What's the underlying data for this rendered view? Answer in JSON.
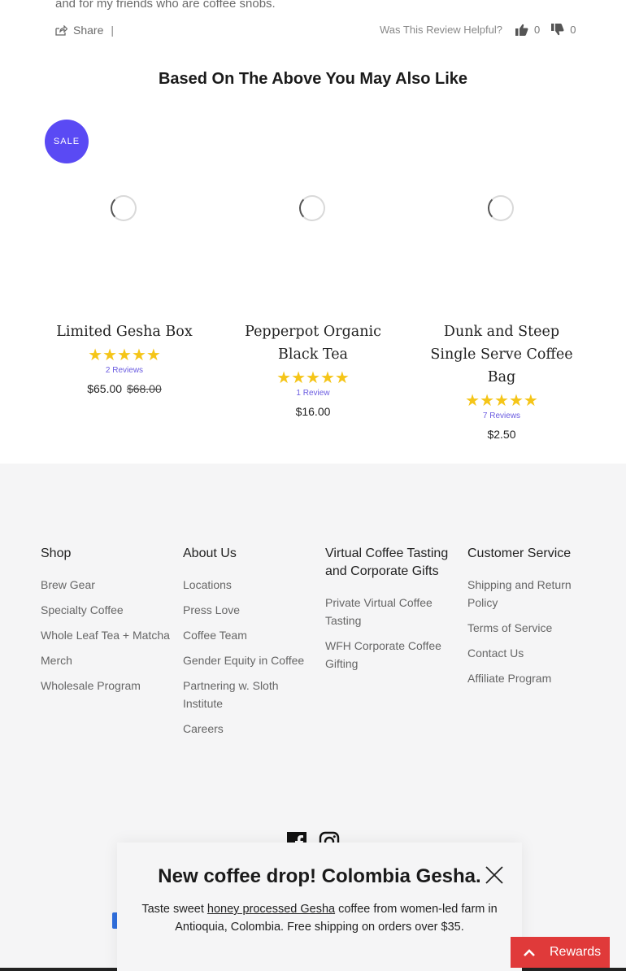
{
  "review": {
    "tail_text": "and for my friends who are coffee snobs.",
    "share_label": "Share",
    "separator": "|",
    "helpful_label": "Was This Review Helpful?",
    "up_count": "0",
    "down_count": "0"
  },
  "recommendations": {
    "title": "Based On The Above You May Also Like",
    "sale_badge": "SALE",
    "star_color": "#f5c518",
    "products": [
      {
        "name": "Limited Gesha Box",
        "stars": "★★★★★",
        "reviews": "2 Reviews",
        "price": "$65.00",
        "old_price": "$68.00"
      },
      {
        "name": "Pepperpot Organic Black Tea",
        "stars": "★★★★★",
        "reviews": "1 Review",
        "price": "$16.00"
      },
      {
        "name": "Dunk and Steep Single Serve Coffee Bag",
        "stars": "★★★★★",
        "reviews": "7 Reviews",
        "price": "$2.50"
      }
    ]
  },
  "footer": {
    "columns": [
      {
        "title": "Shop",
        "links": [
          "Brew Gear",
          "Specialty Coffee",
          "Whole Leaf Tea + Matcha",
          "Merch",
          "Wholesale Program"
        ]
      },
      {
        "title": "About Us",
        "links": [
          "Locations",
          "Press Love",
          "Coffee Team",
          "Gender Equity in Coffee",
          "Partnering w. Sloth Institute",
          "Careers"
        ]
      },
      {
        "title": "Virtual Coffee Tasting and Corporate Gifts",
        "links": [
          "Private Virtual Coffee Tasting",
          "WFH Corporate Coffee Gifting"
        ]
      },
      {
        "title": "Customer Service",
        "links": [
          "Shipping and Return Policy",
          "Terms of Service",
          "Contact Us",
          "Affiliate Program"
        ]
      }
    ],
    "social_icons": [
      "facebook-icon",
      "instagram-icon"
    ]
  },
  "popup": {
    "title": "New coffee drop! Colombia Gesha.",
    "text_before": "Taste sweet ",
    "link_text": "honey processed Gesha",
    "text_after": " coffee from women-led farm in Antioquia, Colombia. Free shipping on orders over $35."
  },
  "rewards": {
    "label": "Rewards",
    "color": "#e03a3a"
  },
  "colors": {
    "accent": "#5a4af4",
    "footer_bg": "#f5f5f6"
  }
}
